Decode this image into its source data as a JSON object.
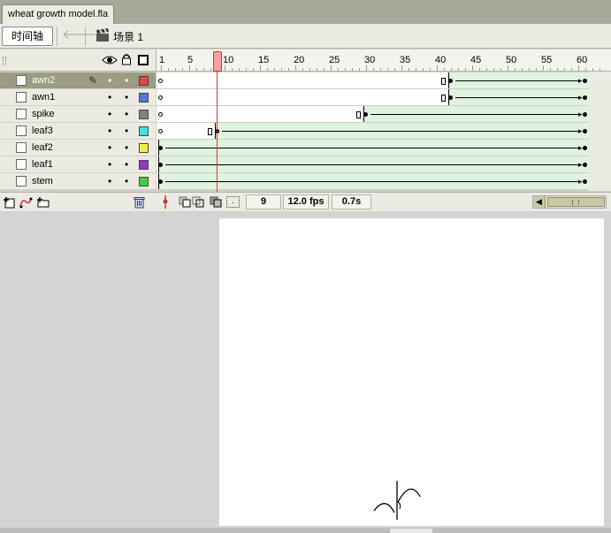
{
  "document": {
    "tab_title": "wheat growth model.fla"
  },
  "toolbar": {
    "timeline_label": "时间轴",
    "back_icon": "back-arrow-icon",
    "scene_icon": "clapperboard-icon",
    "scene_label": "场景 1"
  },
  "layer_header": {
    "eye_icon": "eye-icon",
    "lock_icon": "lock-icon",
    "outline_icon": "outline-square-icon"
  },
  "ruler": {
    "labels": [
      "1",
      "5",
      "10",
      "15",
      "20",
      "25",
      "30",
      "35",
      "40",
      "45",
      "50",
      "55",
      "60"
    ]
  },
  "layers": [
    {
      "name": "awn2",
      "color": "#e04848",
      "selected": true
    },
    {
      "name": "awn1",
      "color": "#5577dd",
      "selected": false
    },
    {
      "name": "spike",
      "color": "#808080",
      "selected": false
    },
    {
      "name": "leaf3",
      "color": "#44e0e0",
      "selected": false
    },
    {
      "name": "leaf2",
      "color": "#f0f040",
      "selected": false
    },
    {
      "name": "leaf1",
      "color": "#9933cc",
      "selected": false
    },
    {
      "name": "stem",
      "color": "#44cc44",
      "selected": false
    }
  ],
  "frames": [
    {
      "layer": "awn2",
      "blank_until": 41,
      "tween_start": 42,
      "end": 61
    },
    {
      "layer": "awn1",
      "blank_until": 41,
      "tween_start": 42,
      "end": 61
    },
    {
      "layer": "spike",
      "blank_until": 29,
      "tween_start": 30,
      "end": 61
    },
    {
      "layer": "leaf3",
      "blank_until": 8,
      "tween_start": 9,
      "end": 61
    },
    {
      "layer": "leaf2",
      "blank_until": 0,
      "tween_start": 1,
      "end": 61
    },
    {
      "layer": "leaf1",
      "blank_until": 0,
      "tween_start": 1,
      "end": 61
    },
    {
      "layer": "stem",
      "blank_until": 0,
      "tween_start": 1,
      "end": 61
    }
  ],
  "playhead": {
    "frame": 9
  },
  "status": {
    "current_frame": "9",
    "fps": "12.0 fps",
    "elapsed": "0.7s"
  },
  "layer_footer": {
    "insert_layer_icon": "insert-layer-icon",
    "add_guide_icon": "add-motion-guide-icon",
    "insert_folder_icon": "insert-folder-icon",
    "delete_icon": "trash-icon"
  }
}
